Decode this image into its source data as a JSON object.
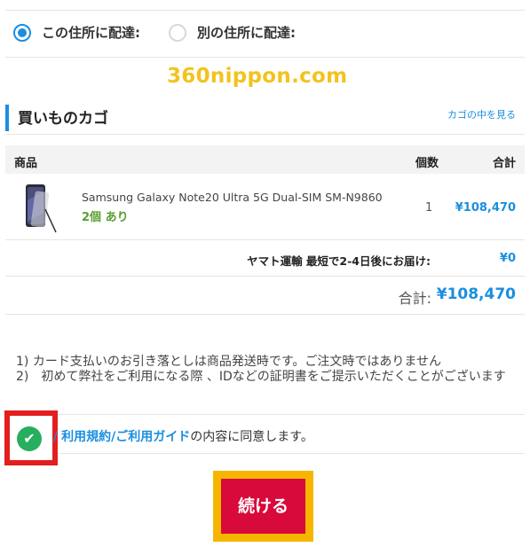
{
  "delivery": {
    "option_this": "この住所に配達:",
    "option_other": "別の住所に配達:",
    "selected": "this"
  },
  "watermark": "360nippon.com",
  "cart": {
    "title": "買いものカゴ",
    "view_link": "カゴの中を見る",
    "columns": {
      "product": "商品",
      "qty": "個数",
      "total": "合計"
    },
    "item": {
      "name": "Samsung Galaxy Note20 Ultra 5G Dual-SIM SM-N9860",
      "stock": "2個 あり",
      "qty": "1",
      "price": "¥108,470",
      "image_icon": "phone-image"
    },
    "shipping_label": "ヤマト運輸 最短で2-4日後にお届け:",
    "shipping_price": "¥0",
    "total_label": "合計:",
    "total_value": "¥108,470"
  },
  "notes": {
    "line1": "1) カード支払いのお引き落としは商品発送時です。ご注文時ではありません",
    "line2": "2)　初めて弊社をご利用になる際 、IDなどの証明書をご提示いただくことがございます"
  },
  "agree": {
    "prefix": "/",
    "link": "利用規約/ご利用ガイド",
    "suffix": "の内容に同意します。",
    "checked": true
  },
  "continue_button": "続ける",
  "colors": {
    "accent_blue": "#1a8ee0",
    "stock_green": "#5a9e2f",
    "button_red": "#d8093b",
    "highlight_red": "#e41e1e",
    "highlight_yellow": "#f6b600"
  }
}
